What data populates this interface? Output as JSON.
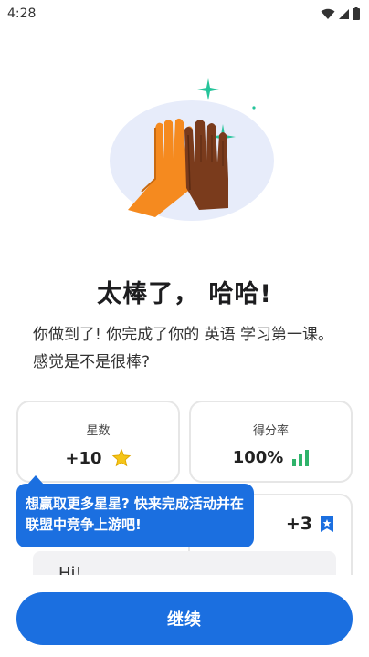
{
  "status_bar": {
    "time": "4:28"
  },
  "headline": "太棒了， 哈哈!",
  "subtext": "你做到了! 你完成了你的 英语 学习第一课。感觉是不是很棒?",
  "stats": [
    {
      "label": "星数",
      "value": "+10",
      "icon": "star-icon"
    },
    {
      "label": "得分率",
      "value": "100%",
      "icon": "bar-chart-icon"
    }
  ],
  "league": {
    "value": "+3",
    "icon": "league-badge-icon",
    "preview_text": "Hi!"
  },
  "tooltip": {
    "text": "想赢取更多星星? 快来完成活动并在联盟中竞争上游吧!"
  },
  "continue_button": {
    "label": "继续"
  },
  "colors": {
    "accent": "#1b6fe0",
    "star": "#f5c518",
    "chart": "#2fb36a"
  }
}
